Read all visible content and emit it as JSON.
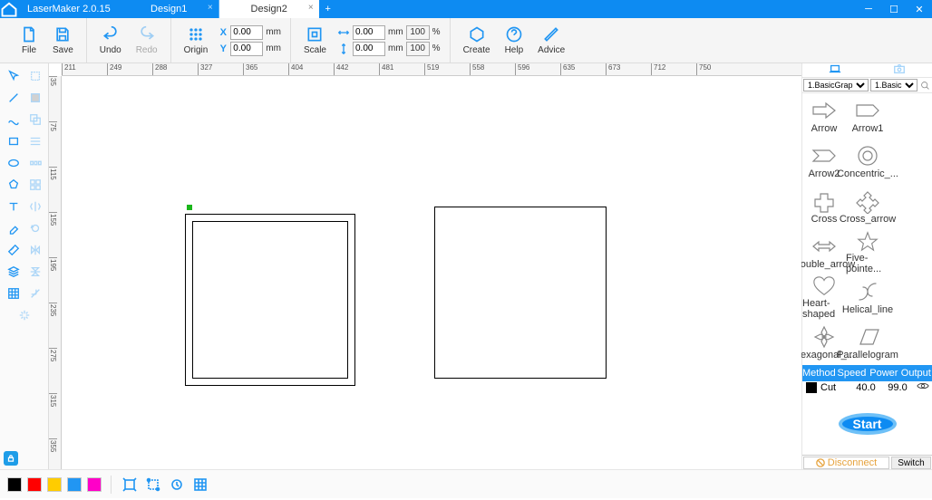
{
  "app": {
    "name": "LaserMaker 2.0.15"
  },
  "tabs": [
    {
      "label": "Design1",
      "active": false
    },
    {
      "label": "Design2",
      "active": true
    }
  ],
  "toolbar": {
    "file": "File",
    "save": "Save",
    "undo": "Undo",
    "redo": "Redo",
    "origin": "Origin",
    "scale": "Scale",
    "create": "Create",
    "help": "Help",
    "advice": "Advice",
    "coords": {
      "x_label": "X",
      "y_label": "Y",
      "x_val": "0.00",
      "y_val": "0.00",
      "unit": "mm",
      "w_val": "0.00",
      "h_val": "0.00",
      "w_pct": "100",
      "h_pct": "100",
      "pct_sym": "%"
    }
  },
  "ruler_h": [
    "211",
    "249",
    "288",
    "327",
    "365",
    "404",
    "442",
    "481",
    "519",
    "558",
    "596",
    "635",
    "673",
    "712",
    "750"
  ],
  "ruler_v": [
    "35",
    "75",
    "115",
    "155",
    "195",
    "235",
    "275",
    "315",
    "355"
  ],
  "shapes": {
    "categories": [
      "1.BasicGrap",
      "1.Basic"
    ],
    "items": [
      {
        "name": "Arrow"
      },
      {
        "name": "Arrow1"
      },
      {
        "name": "Arrow2"
      },
      {
        "name": "Concentric_..."
      },
      {
        "name": "Cross"
      },
      {
        "name": "Cross_arrow"
      },
      {
        "name": "Double_arrow"
      },
      {
        "name": "Five-pointe..."
      },
      {
        "name": "Heart-shaped"
      },
      {
        "name": "Helical_line"
      },
      {
        "name": "Hexagonal_..."
      },
      {
        "name": "Parallelogram"
      }
    ]
  },
  "layers": {
    "headers": {
      "method": "Method",
      "speed": "Speed",
      "power": "Power",
      "output": "Output"
    },
    "rows": [
      {
        "color": "#000",
        "method": "Cut",
        "speed": "40.0",
        "power": "99.0"
      }
    ]
  },
  "start": "Start",
  "bottom": {
    "disconnect": "Disconnect",
    "switch": "Switch"
  },
  "palette": [
    "#000000",
    "#ff0000",
    "#ffcc00",
    "#2196f3",
    "#ff00c8"
  ]
}
